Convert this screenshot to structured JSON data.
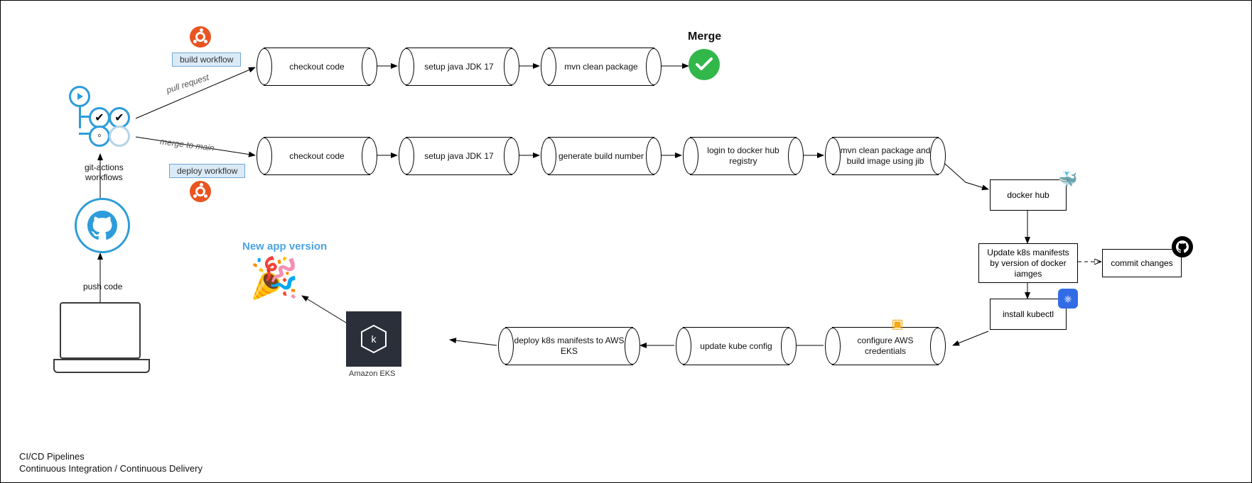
{
  "footer": {
    "line1": "CI/CD Pipelines",
    "line2": "Continuous Integration / Continuous Delivery"
  },
  "left": {
    "push_code_label": "push code",
    "git_actions_label_line1": "git-actions",
    "git_actions_label_line2": "workflows"
  },
  "branches": {
    "pull_request_label": "pull request",
    "merge_to_main_label": "merge to main"
  },
  "workflows": {
    "build_tag": "build workflow",
    "deploy_tag": "deploy workflow"
  },
  "build_row": {
    "steps": {
      "s1": "checkout code",
      "s2": "setup java JDK 17",
      "s3": "mvn clean package"
    },
    "merge_label": "Merge"
  },
  "deploy_row": {
    "steps": {
      "s1": "checkout code",
      "s2": "setup java JDK 17",
      "s3": "generate build number",
      "s4": "login to docker hub registry",
      "s5": "mvn clean package and build image using jib"
    }
  },
  "right_column": {
    "docker_hub": "docker hub",
    "update_manifests": "Update k8s manifests by version of docker iamges",
    "install_kubectl": "install kubectl",
    "commit_changes": "commit changes"
  },
  "bottom_row": {
    "configure_aws": "configure AWS credentials",
    "update_kube_config": "update kube config",
    "deploy_manifests": "deploy k8s manifests to AWS EKS",
    "amazon_eks_label": "Amazon EKS",
    "new_app_version": "New app version"
  },
  "icons": {
    "ubuntu": "ubuntu-icon",
    "check": "check-icon",
    "github": "github-icon",
    "docker": "docker-icon",
    "kubernetes": "kubernetes-icon",
    "aws": "aws-icon",
    "party": "party-icon",
    "eks": "amazon-eks-icon"
  }
}
